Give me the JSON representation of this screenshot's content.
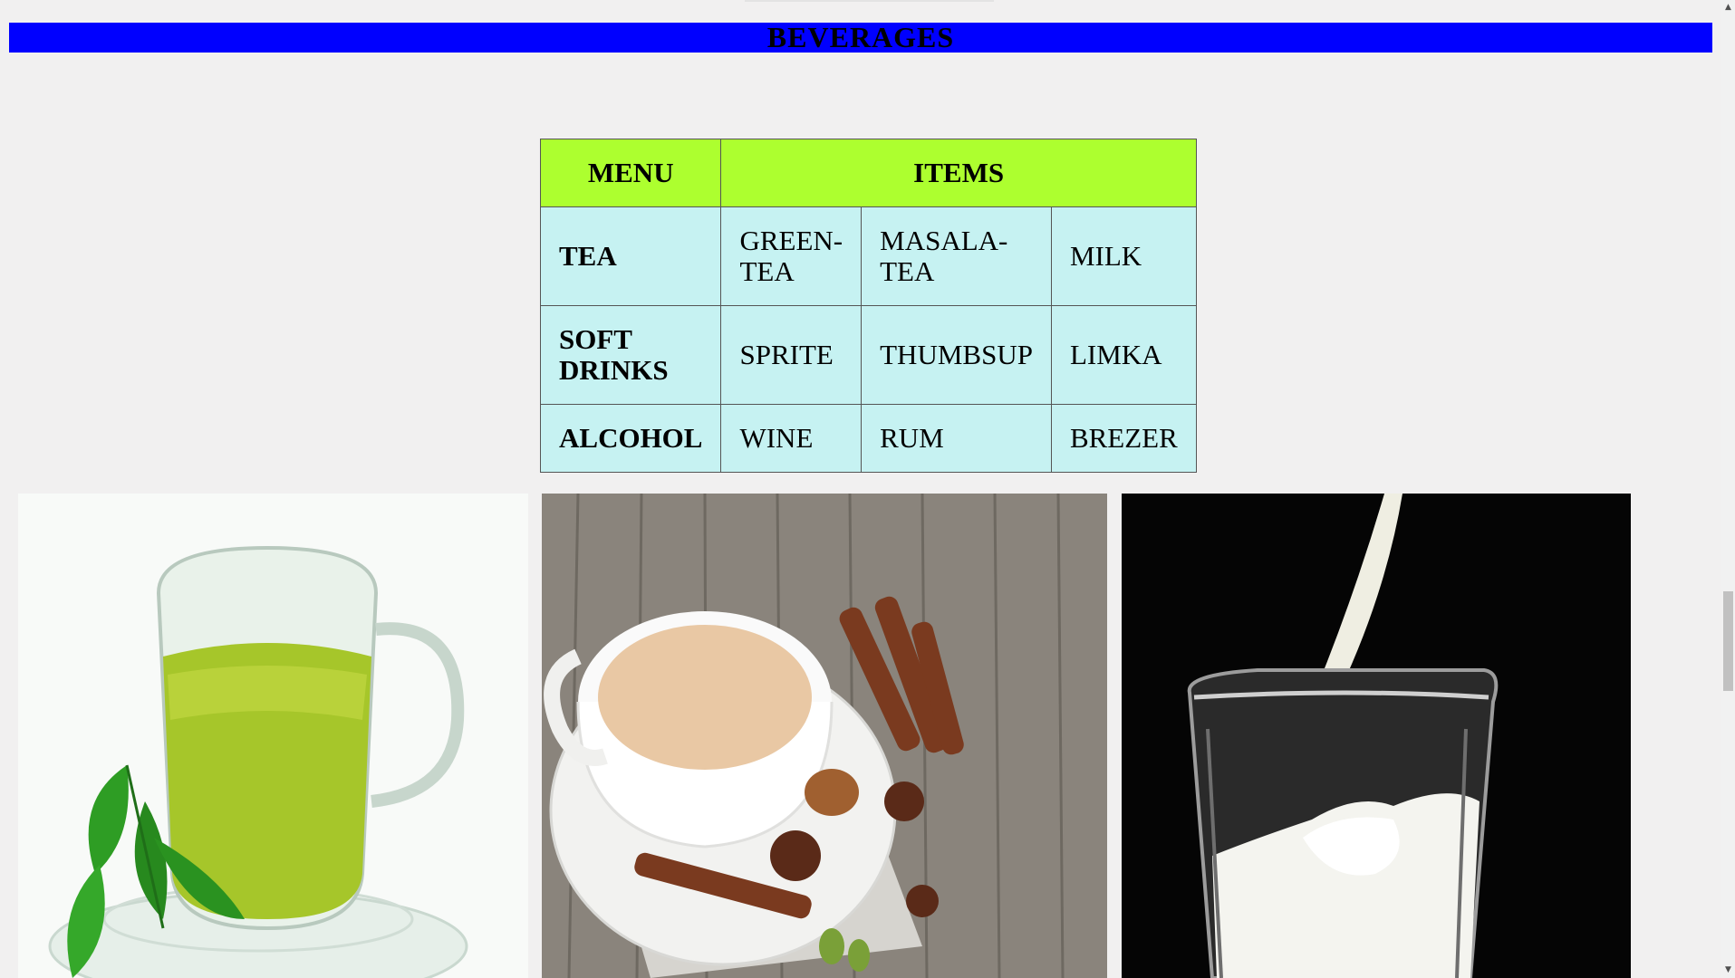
{
  "banner": {
    "title": "BEVERAGES",
    "background": "#0000ff"
  },
  "table": {
    "headers": {
      "menu": "MENU",
      "items": "ITEMS"
    },
    "header_color": "#adff2f",
    "cell_color": "#c6f2f2",
    "rows": [
      {
        "category": "TEA",
        "items": [
          "GREEN-TEA",
          "MASALA-TEA",
          "MILK"
        ]
      },
      {
        "category": "SOFT DRINKS",
        "items": [
          "SPRITE",
          "THUMBSUP",
          "LIMKA"
        ]
      },
      {
        "category": "ALCOHOL",
        "items": [
          "WINE",
          "RUM",
          "BREZER"
        ]
      }
    ]
  },
  "images": [
    {
      "subject": "green tea in glass cup with leaves"
    },
    {
      "subject": "masala tea cup with cinnamon and star anise"
    },
    {
      "subject": "milk pouring into glass"
    }
  ],
  "scrollbar": {
    "up_icon": "arrow-up-icon",
    "down_icon": "arrow-down-icon",
    "scroll_fraction": 0.6
  }
}
